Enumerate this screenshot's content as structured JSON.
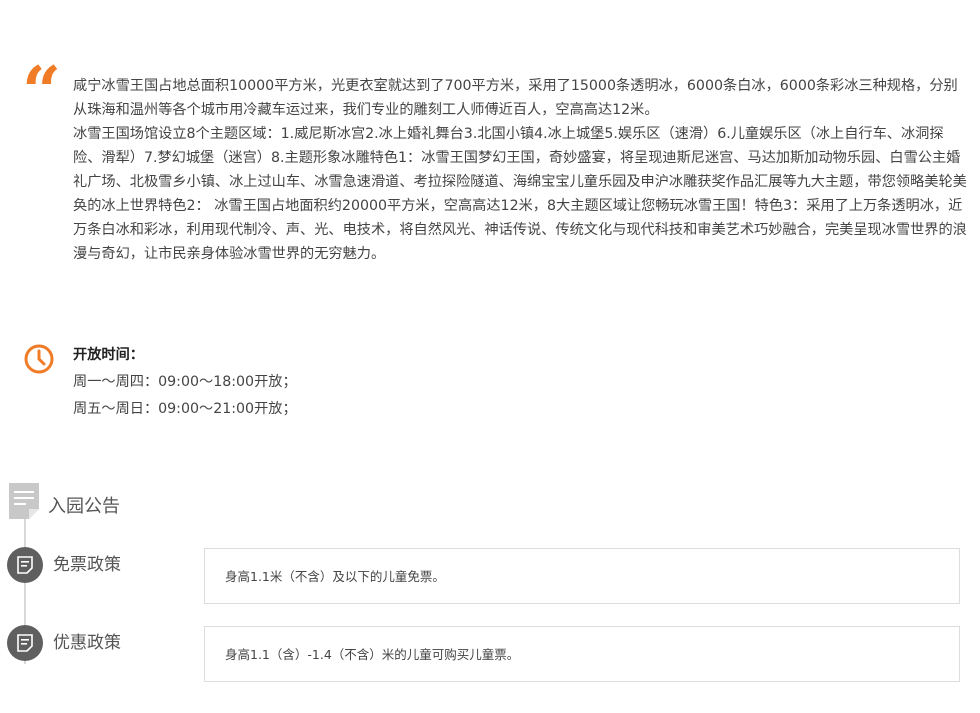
{
  "description": {
    "paragraphs": [
      "咸宁冰雪王国占地总面积10000平方米，光更衣室就达到了700平方米，采用了15000条透明冰，6000条白冰，6000条彩冰三种规格，分别从珠海和温州等各个城市用冷藏车运过来，我们专业的雕刻工人师傅近百人，空高高达12米。",
      "冰雪王国场馆设立8个主题区域：1.威尼斯冰宫2.冰上婚礼舞台3.北国小镇4.冰上城堡5.娱乐区（速滑）6.儿童娱乐区（冰上自行车、冰洞探险、滑犁）7.梦幻城堡（迷宫）8.主题形象冰雕特色1：冰雪王国梦幻王国，奇妙盛宴，将呈现迪斯尼迷宫、马达加斯加动物乐园、白雪公主婚礼广场、北极雪乡小镇、冰上过山车、冰雪急速滑道、考拉探险隧道、海绵宝宝儿童乐园及申沪冰雕获奖作品汇展等九大主题，带您领略美轮美奂的冰上世界特色2： 冰雪王国占地面积约20000平方米，空高高达12米，8大主题区域让您畅玩冰雪王国！特色3：采用了上万条透明冰，近万条白冰和彩冰，利用现代制冷、声、光、电技术，将自然风光、神话传说、传统文化与现代科技和审美艺术巧妙融合，完美呈现冰雪世界的浪漫与奇幻，让市民亲身体验冰雪世界的无穷魅力。"
    ],
    "quote_mark": "“"
  },
  "hours": {
    "title": "开放时间：",
    "lines": [
      "周一～周四：09:00～18:00开放；",
      "周五～周日：09:00～21:00开放；"
    ]
  },
  "notice": {
    "title": "入园公告",
    "policies": [
      {
        "label": "免票政策",
        "text": "身高1.1米（不含）及以下的儿童免票。"
      },
      {
        "label": "优惠政策",
        "text": "身高1.1（含）-1.4（不含）米的儿童可购买儿童票。"
      }
    ]
  },
  "colors": {
    "accent": "#f07c28",
    "icon_dark": "#5f5f5f",
    "border": "#dddddd"
  },
  "icons": {
    "quote": "quote-icon",
    "clock": "clock-icon",
    "notice": "document-icon",
    "policy": "note-icon"
  }
}
